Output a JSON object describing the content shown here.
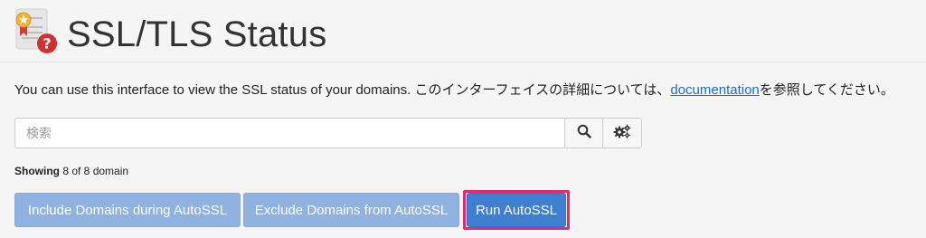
{
  "page": {
    "title": "SSL/TLS Status",
    "icon": "certificate-question-icon"
  },
  "description": {
    "text": "You can use this interface to view the SSL status of your domains. このインターフェイスの詳細については、",
    "link_label": "documentation",
    "suffix": "を参照してください。"
  },
  "search": {
    "placeholder": "検索",
    "value": "",
    "search_icon": "search-icon",
    "settings_icon": "gears-icon"
  },
  "showing": {
    "label": "Showing",
    "rest": " 8 of 8 domain"
  },
  "actions": {
    "include_label": "Include Domains during AutoSSL",
    "exclude_label": "Exclude Domains from AutoSSL",
    "run_label": "Run AutoSSL"
  },
  "colors": {
    "primary": "#3f7fd0",
    "primary_disabled": "#8fb2e0",
    "highlight": "#e22b72",
    "link": "#1a6fc0"
  }
}
